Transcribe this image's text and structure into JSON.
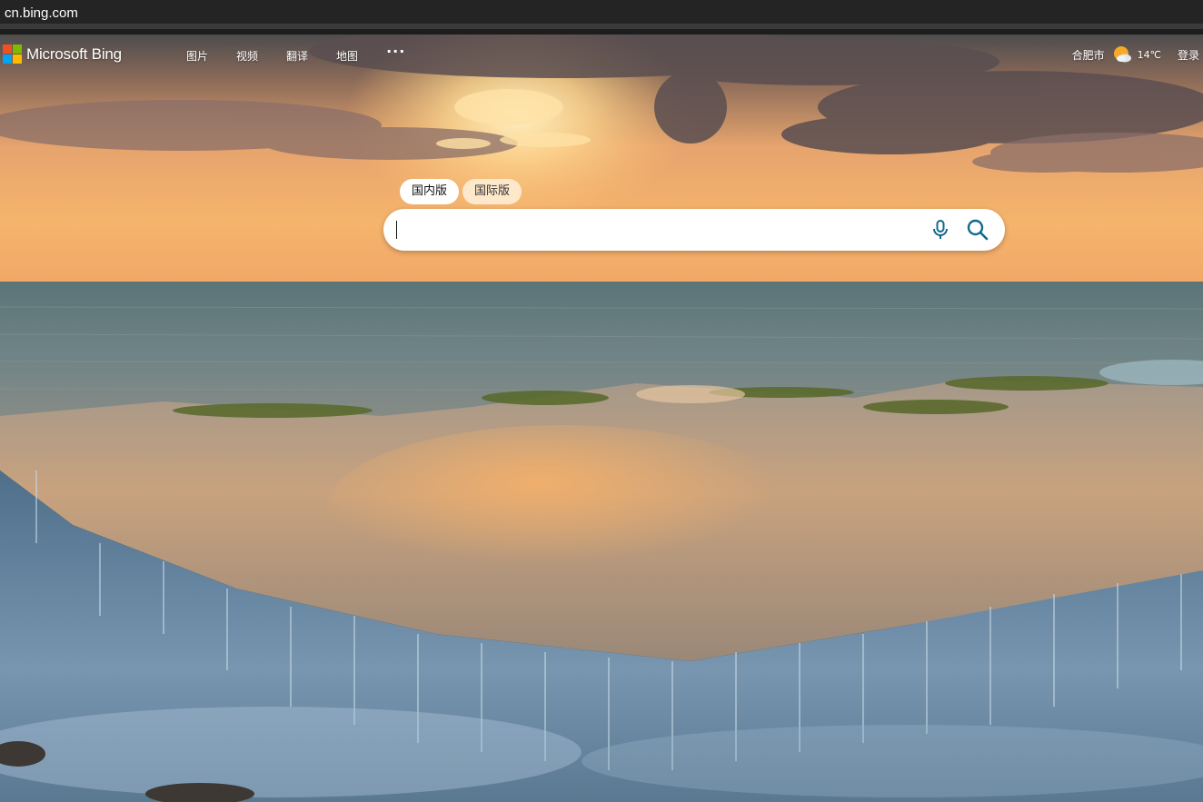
{
  "browser": {
    "address": "cn.bing.com"
  },
  "header": {
    "logo_text": "Microsoft Bing",
    "logo_colors": [
      "#f25022",
      "#7fba00",
      "#00a4ef",
      "#ffb900"
    ],
    "nav": [
      "图片",
      "视频",
      "翻译",
      "地图"
    ],
    "more_label": "···",
    "city": "合肥市",
    "weather_icon": "partly-sunny-icon",
    "temperature": "14℃",
    "login": "登录"
  },
  "search": {
    "tabs": [
      "国内版",
      "国际版"
    ],
    "active_tab": "国内版",
    "value": "",
    "placeholder": "",
    "accent": "#0f6a8a"
  },
  "background": {
    "description_icon": "ocean-waterfall-sunset-photo"
  }
}
